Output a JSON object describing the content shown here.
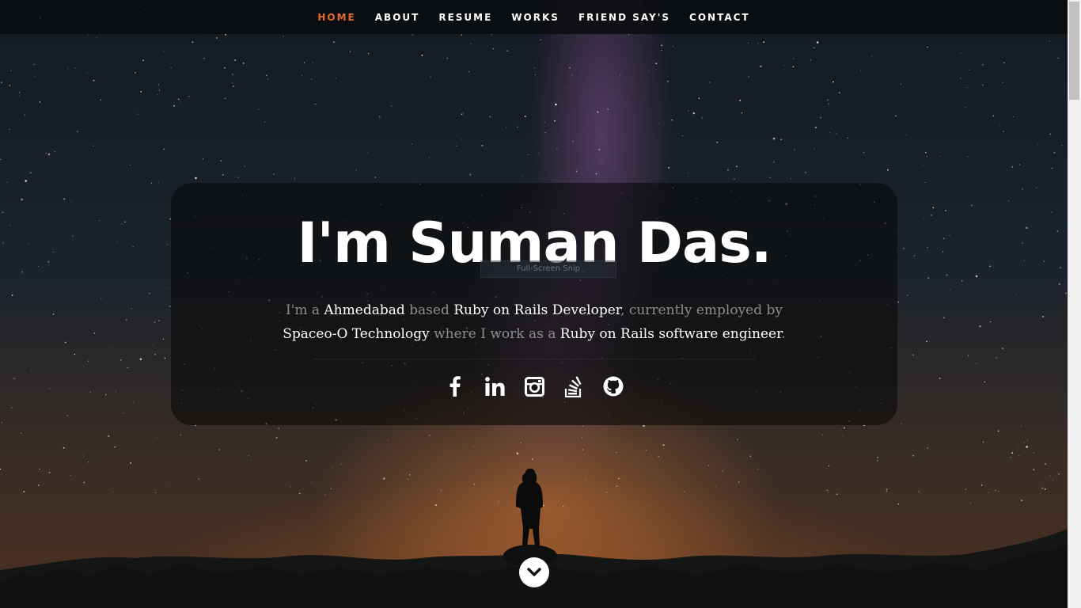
{
  "nav": {
    "items": [
      {
        "label": "HOME",
        "active": true
      },
      {
        "label": "ABOUT",
        "active": false
      },
      {
        "label": "RESUME",
        "active": false
      },
      {
        "label": "WORKS",
        "active": false
      },
      {
        "label": "FRIEND SAY'S",
        "active": false
      },
      {
        "label": "CONTACT",
        "active": false
      }
    ]
  },
  "hero": {
    "headline": "I'm Suman Das.",
    "overlay_text": "Full-Screen Snip",
    "intro": {
      "p1": "I'm a ",
      "city": "Ahmedabad",
      "p2": " based ",
      "role": "Ruby on Rails Developer",
      "p3": ", currently employed by ",
      "company": "Spaceo-O Technology",
      "p4": " where I work as a ",
      "position": "Ruby on Rails software engineer",
      "p5": "."
    },
    "social_icons": [
      "facebook-icon",
      "linkedin-icon",
      "instagram-icon",
      "stackoverflow-icon",
      "github-icon"
    ],
    "scroll_icon": "chevron-down-icon"
  },
  "colors": {
    "accent": "#e8692f",
    "nav_bg": "#0a0c0e",
    "text_highlight": "#ffffff",
    "text_muted": "#8d8d8d"
  }
}
